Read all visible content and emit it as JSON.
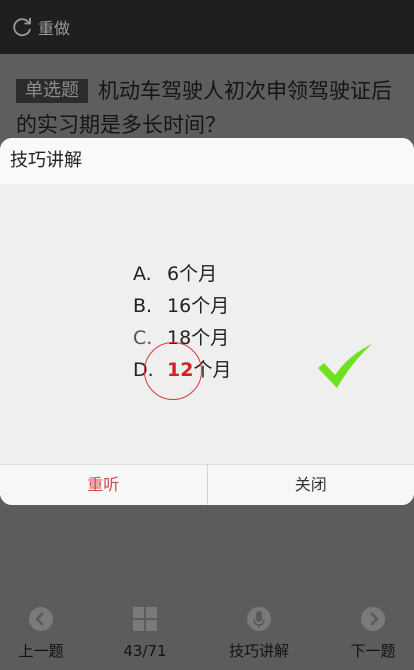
{
  "header": {
    "redo_label": "重做"
  },
  "question": {
    "type_badge": "单选题",
    "text": "机动车驾驶人初次申领驾驶证后的实习期是多长时间？"
  },
  "modal": {
    "title": "技巧讲解",
    "options": [
      {
        "letter": "A.",
        "value": "6",
        "unit": "个月"
      },
      {
        "letter": "B.",
        "value": "16",
        "unit": "个月"
      },
      {
        "letter": "C.",
        "value": "18",
        "unit": "个月"
      },
      {
        "letter": "D.",
        "value": "12",
        "unit": "个月"
      }
    ],
    "replay_label": "重听",
    "close_label": "关闭"
  },
  "bottom": {
    "prev_label": "上一题",
    "progress": "43/71",
    "tips_label": "技巧讲解",
    "next_label": "下一题"
  },
  "colors": {
    "highlight": "#d42020",
    "check": "#6ee21c",
    "replay": "#d24a4a"
  }
}
